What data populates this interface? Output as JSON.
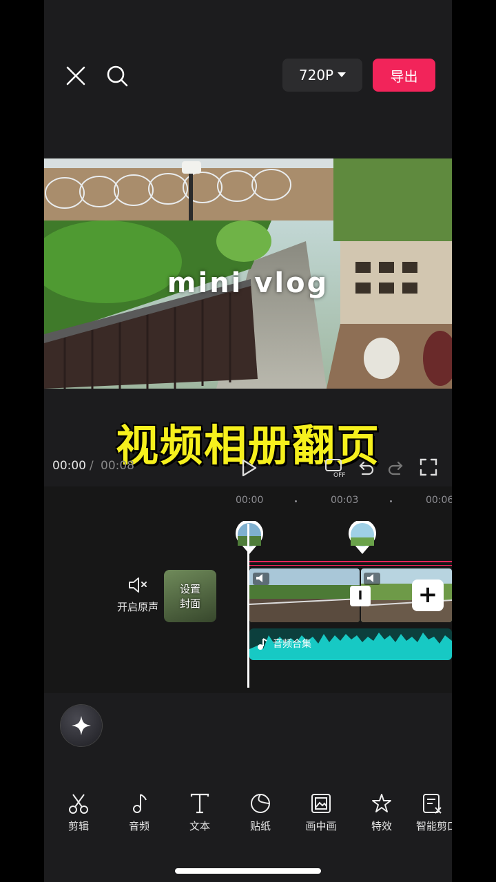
{
  "top_bar": {
    "resolution": "720P",
    "export_label": "导出",
    "close_icon": "close-icon",
    "search_icon": "search-icon"
  },
  "preview": {
    "overlay_title": "mini  vlog",
    "banner_text": "视频相册翻页"
  },
  "playback": {
    "current_time": "00:00",
    "separator": "/",
    "total_time": "00:08"
  },
  "timeline": {
    "ruler": [
      "00:00",
      "00:03",
      "00:06"
    ],
    "mute_label": "开启原声",
    "cover_label": "设置\n封面",
    "audio_label": "音频合集",
    "add_icon": "plus-icon",
    "transition_icon": "transition-icon"
  },
  "toolbar": {
    "items": [
      {
        "label": "剪辑",
        "icon": "scissors-icon"
      },
      {
        "label": "音频",
        "icon": "music-note-icon"
      },
      {
        "label": "文本",
        "icon": "text-icon"
      },
      {
        "label": "贴纸",
        "icon": "sticker-icon"
      },
      {
        "label": "画中画",
        "icon": "picture-in-picture-icon"
      },
      {
        "label": "特效",
        "icon": "effects-star-icon"
      },
      {
        "label": "智能剪口",
        "icon": "smart-cut-icon"
      }
    ]
  },
  "colors": {
    "accent": "#f2245a",
    "audio": "#17c9c4",
    "banner": "#f6f01d",
    "background": "#1c1c1e"
  }
}
